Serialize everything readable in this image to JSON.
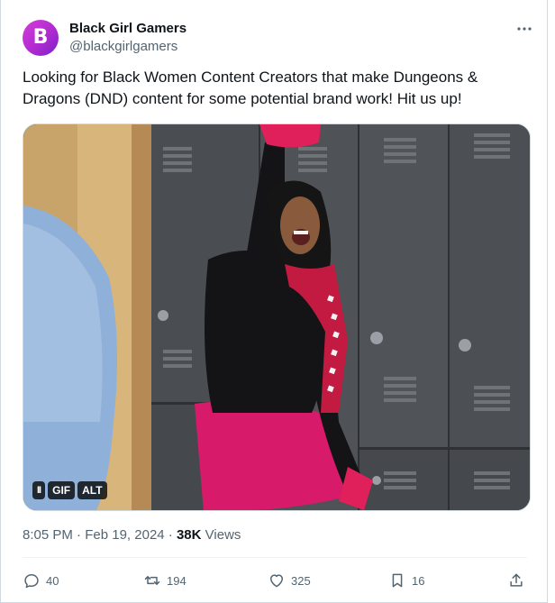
{
  "author": {
    "display_name": "Black Girl Gamers",
    "handle": "@blackgirlgamers",
    "avatar_letter": "B"
  },
  "tweet": {
    "text": "Looking for Black Women Content Creators that make Dungeons & Dragons (DND) content for some potential brand work! Hit us up!",
    "time": "8:05 PM",
    "date": "Feb 19, 2024",
    "views_count": "38K",
    "views_label": "Views",
    "separator": "·"
  },
  "media": {
    "pause_label": "II",
    "gif_label": "GIF",
    "alt_label": "ALT"
  },
  "actions": {
    "replies": "40",
    "reposts": "194",
    "likes": "325",
    "bookmarks": "16"
  },
  "colors": {
    "accent": "#1d9bf0",
    "secondary_text": "#536471",
    "primary_text": "#0f1419",
    "avatar": "#c030d0"
  }
}
